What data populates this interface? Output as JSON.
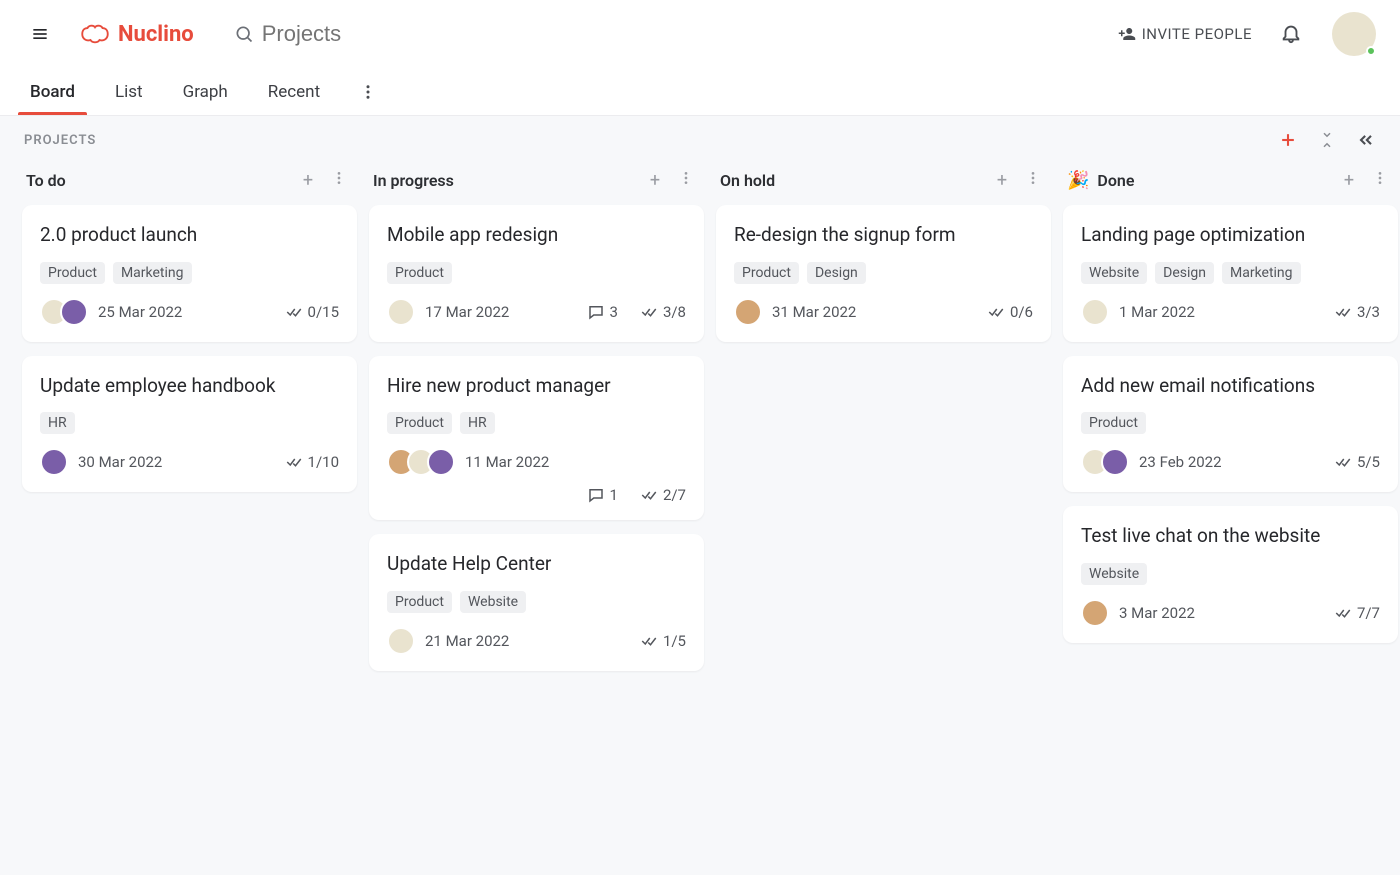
{
  "app_name": "Nuclino",
  "search_placeholder": "Projects",
  "invite_label": "INVITE PEOPLE",
  "tabs": {
    "items": [
      "Board",
      "List",
      "Graph",
      "Recent"
    ],
    "active": 0
  },
  "board_title": "PROJECTS",
  "columns": [
    {
      "title": "To do",
      "emoji": "",
      "cards": [
        {
          "title": "2.0 product launch",
          "tags": [
            "Product",
            "Marketing"
          ],
          "avatars": [
            "av1",
            "av2"
          ],
          "date": "25 Mar 2022",
          "comments": null,
          "tasks": "0/15",
          "extra_row": false
        },
        {
          "title": "Update employee handbook",
          "tags": [
            "HR"
          ],
          "avatars": [
            "av2"
          ],
          "date": "30 Mar 2022",
          "comments": null,
          "tasks": "1/10",
          "extra_row": false
        }
      ]
    },
    {
      "title": "In progress",
      "emoji": "",
      "cards": [
        {
          "title": "Mobile app redesign",
          "tags": [
            "Product"
          ],
          "avatars": [
            "av1"
          ],
          "date": "17 Mar 2022",
          "comments": "3",
          "tasks": "3/8",
          "extra_row": false
        },
        {
          "title": "Hire new product manager",
          "tags": [
            "Product",
            "HR"
          ],
          "avatars": [
            "av3",
            "av1",
            "av2"
          ],
          "date": "11 Mar 2022",
          "comments": "1",
          "tasks": "2/7",
          "extra_row": true
        },
        {
          "title": "Update Help Center",
          "tags": [
            "Product",
            "Website"
          ],
          "avatars": [
            "av1"
          ],
          "date": "21 Mar 2022",
          "comments": null,
          "tasks": "1/5",
          "extra_row": false
        }
      ]
    },
    {
      "title": "On hold",
      "emoji": "",
      "cards": [
        {
          "title": "Re-design the signup form",
          "tags": [
            "Product",
            "Design"
          ],
          "avatars": [
            "av3"
          ],
          "date": "31 Mar 2022",
          "comments": null,
          "tasks": "0/6",
          "extra_row": false
        }
      ]
    },
    {
      "title": "Done",
      "emoji": "🎉",
      "cards": [
        {
          "title": "Landing page optimization",
          "tags": [
            "Website",
            "Design",
            "Marketing"
          ],
          "avatars": [
            "av1"
          ],
          "date": "1 Mar 2022",
          "comments": null,
          "tasks": "3/3",
          "extra_row": false
        },
        {
          "title": "Add new email notifications",
          "tags": [
            "Product"
          ],
          "avatars": [
            "av1",
            "av2"
          ],
          "date": "23 Feb 2022",
          "comments": null,
          "tasks": "5/5",
          "extra_row": false
        },
        {
          "title": "Test live chat on the website",
          "tags": [
            "Website"
          ],
          "avatars": [
            "av3"
          ],
          "date": "3 Mar 2022",
          "comments": null,
          "tasks": "7/7",
          "extra_row": false
        }
      ]
    }
  ]
}
